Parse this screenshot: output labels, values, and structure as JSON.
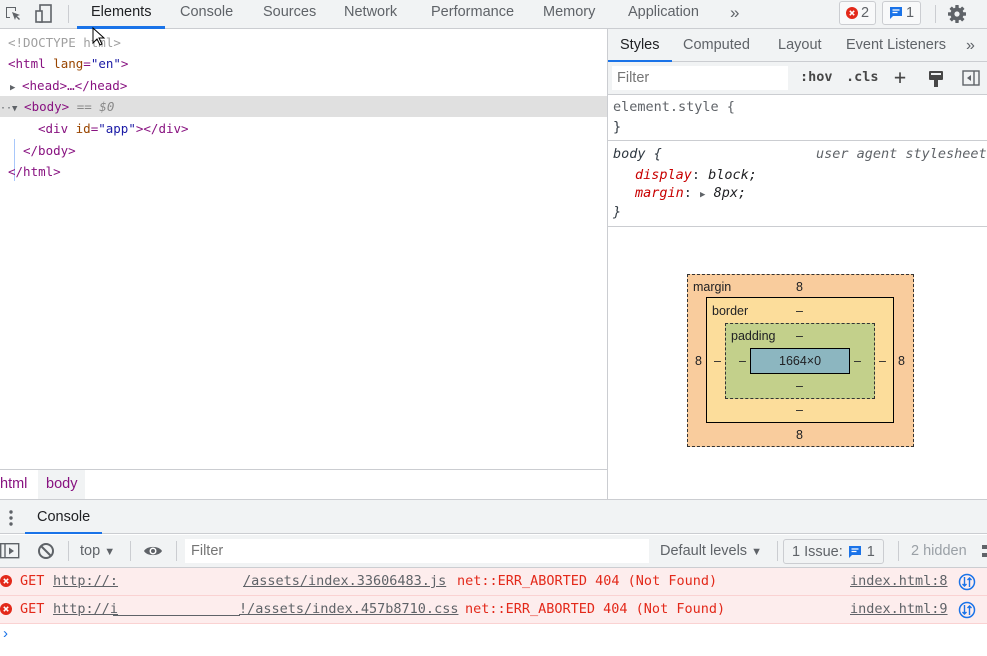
{
  "topbar": {
    "tabs": [
      "Elements",
      "Console",
      "Sources",
      "Network",
      "Performance",
      "Memory",
      "Application"
    ],
    "active_tab": "Elements",
    "more_tabs": "»",
    "error_count": "2",
    "issue_count": "1"
  },
  "dom": {
    "doctype": "<!DOCTYPE html>",
    "html_open_tag": "<html",
    "html_attr_name": "lang",
    "html_attr_value": "\"en\"",
    "html_open_close": ">",
    "head": "<head>…</head>",
    "body_open": "<body>",
    "body_ref": "== $0",
    "div_open": "<div",
    "div_attr_name": "id",
    "div_attr_value": "\"app\"",
    "div_close": "></div>",
    "body_close": "</body>",
    "html_close": "</html>"
  },
  "breadcrumbs": [
    "html",
    "body"
  ],
  "styles": {
    "tabs": [
      "Styles",
      "Computed",
      "Layout",
      "Event Listeners"
    ],
    "active_tab": "Styles",
    "more_tabs": "»",
    "filter_placeholder": "Filter",
    "hov": ":hov",
    "cls": ".cls",
    "add": "+",
    "rules": [
      {
        "selector": "element.style {",
        "close": "}",
        "source": "",
        "props": []
      },
      {
        "selector": "body {",
        "close": "}",
        "source": "user agent stylesheet",
        "props": [
          {
            "name": "display",
            "value": "block;"
          },
          {
            "name": "margin",
            "value": "8px;"
          }
        ]
      }
    ]
  },
  "box_model": {
    "margin_label": "margin",
    "margin": {
      "top": "8",
      "right": "8",
      "bottom": "8",
      "left": "8"
    },
    "border_label": "border",
    "border": {
      "top": "–",
      "right": "–",
      "bottom": "–",
      "left": "–"
    },
    "padding_label": "padding",
    "padding": {
      "top": "–",
      "right": "–",
      "bottom": "–",
      "left": "–"
    },
    "content": "1664×0"
  },
  "drawer": {
    "tab": "Console"
  },
  "console_toolbar": {
    "context": "top",
    "filter_placeholder": "Filter",
    "levels": "Default levels",
    "issues_label": "1 Issue:",
    "issues_count": "1",
    "hidden": "2 hidden"
  },
  "messages": [
    {
      "method": "GET",
      "url_start": "http://:",
      "url_end": "/assets/index.33606483.js",
      "error": "net::ERR_ABORTED 404 (Not Found)",
      "source": "index.html:8"
    },
    {
      "method": "GET",
      "url_start": "http://i",
      "url_end": "!/assets/index.457b8710.css",
      "error": "net::ERR_ABORTED 404 (Not Found)",
      "source": "index.html:9"
    }
  ],
  "prompt": "›",
  "colors": {
    "accent": "#1a73e8",
    "error": "#e3291a",
    "error_bg": "#fdeded",
    "tag": "#881280"
  }
}
